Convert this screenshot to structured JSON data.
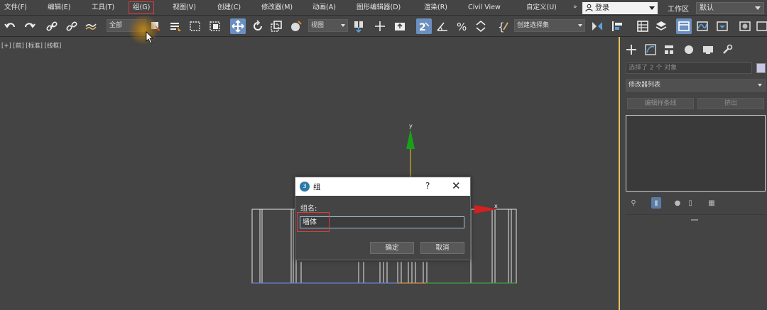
{
  "menu": {
    "items": [
      "文件(F)",
      "编辑(E)",
      "工具(T)",
      "组(G)",
      "视图(V)",
      "创建(C)",
      "修改器(M)",
      "动画(A)",
      "图形编辑器(D)",
      "渲染(R)",
      "Civil View",
      "自定义(U)"
    ],
    "overflow": "»",
    "login_label": "登录",
    "workspace_label": "工作区",
    "workspace_value": "默认"
  },
  "toolbar": {
    "selection_filter": "全部",
    "ref_coord": "视图",
    "named_selection": "创建选择集",
    "icons": [
      "undo-icon",
      "redo-icon",
      "link-icon",
      "unlink-icon",
      "bind-spacewarp-icon",
      "select-object-icon",
      "select-by-name-icon",
      "rect-region-icon",
      "window-crossing-icon",
      "select-move-icon",
      "select-rotate-icon",
      "select-scale-icon",
      "place-icon",
      "pivot-icon",
      "keyboard-shortcut-icon",
      "snap-2d-icon",
      "angle-snap-icon",
      "percent-snap-icon",
      "spinner-snap-icon",
      "edit-named-sets-icon",
      "mirror-icon",
      "align-icon",
      "scene-explorer-icon",
      "layer-explorer-icon",
      "ribbon-icon",
      "curve-editor-icon",
      "schematic-view-icon",
      "material-editor-icon"
    ]
  },
  "viewport": {
    "label": "[+] [前] [标准] [线框]",
    "gizmo_y_label": "y",
    "gizmo_x_label": "x",
    "axis_colors": {
      "x": "#d42020",
      "y": "#18a018"
    }
  },
  "command_panel": {
    "tab_icons": [
      "create-tab-icon",
      "modify-tab-icon",
      "hierarchy-tab-icon",
      "motion-tab-icon",
      "display-tab-icon",
      "utilities-tab-icon"
    ],
    "name_placeholder": "选择了 2 个 对象",
    "modifier_list": "修改器列表",
    "btn_edit_spline": "编辑样条线",
    "btn_extrude": "挤出"
  },
  "dialog": {
    "title": "组",
    "help": "?",
    "close": "✕",
    "name_label": "组名:",
    "name_value": "墙体",
    "ok": "确定",
    "cancel": "取消"
  }
}
